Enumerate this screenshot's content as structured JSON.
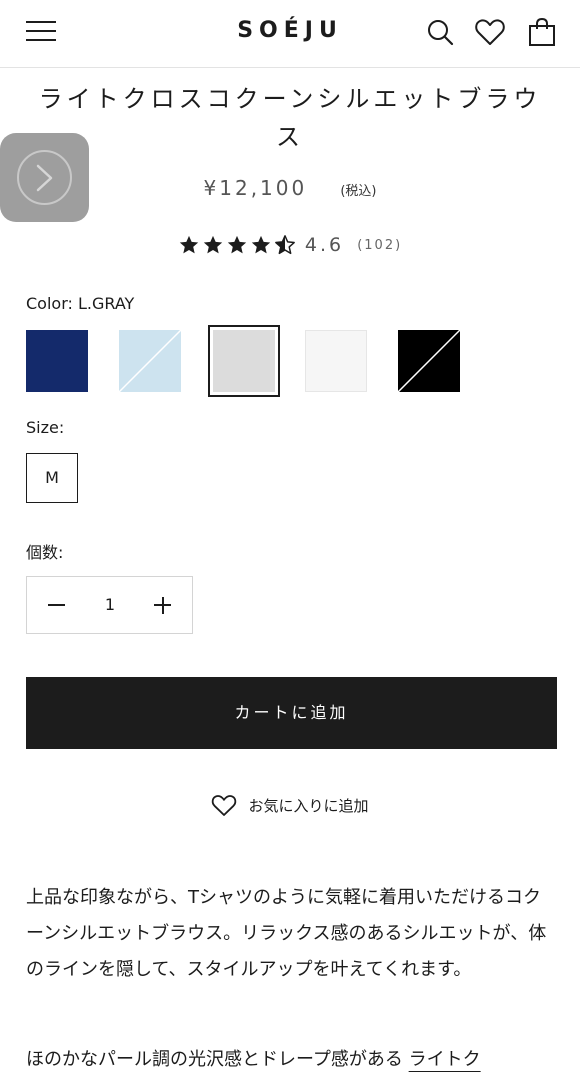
{
  "header": {
    "brand": "SOÉJU",
    "icons": [
      "menu-icon",
      "search-icon",
      "heart-icon",
      "bag-icon"
    ]
  },
  "product": {
    "title": "ライトクロスコクーンシルエットブラウス",
    "price": "¥12,100",
    "tax_note": "(税込)",
    "rating_value": "4.6",
    "rating_count": "(102)",
    "rating": 4.6
  },
  "color": {
    "label": "Color: L.GRAY",
    "swatches": [
      {
        "name": "navy",
        "hex": "#142a6b",
        "available": true
      },
      {
        "name": "light-blue",
        "hex": "#cde3ef",
        "available": false
      },
      {
        "name": "light-gray",
        "hex": "#dcdcdc",
        "available": true,
        "selected": true
      },
      {
        "name": "white",
        "hex": "#f6f6f6",
        "available": true
      },
      {
        "name": "black",
        "hex": "#000000",
        "available": false
      }
    ]
  },
  "size": {
    "label": "Size:",
    "options": [
      "M"
    ]
  },
  "quantity": {
    "label": "個数:",
    "value": "1"
  },
  "actions": {
    "add_to_cart": "カートに追加",
    "add_to_favorites": "お気に入りに追加"
  },
  "description": {
    "paragraph1": "上品な印象ながら、Tシャツのように気軽に着用いただけるコクーンシルエットブラウス。リラックス感のあるシルエットが、体のラインを隠して、スタイルアップを叶えてくれます。",
    "paragraph2_prefix": "ほのかなパール調の光沢感とドレープ感がある ",
    "paragraph2_link": "ライトク"
  }
}
